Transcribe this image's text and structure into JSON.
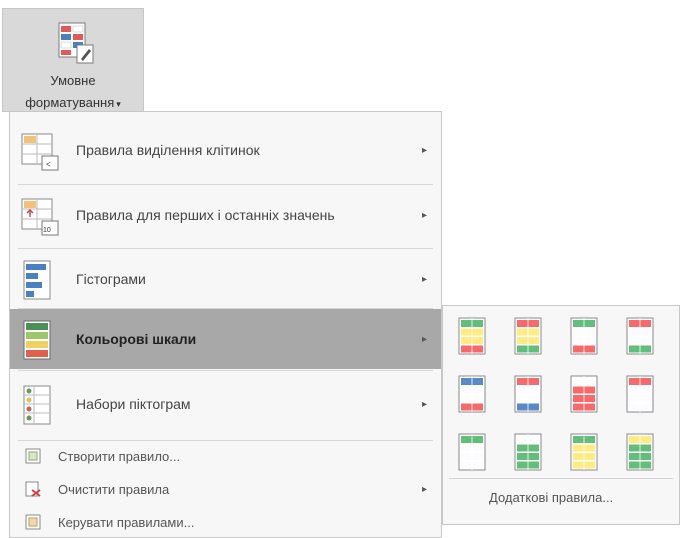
{
  "ribbon": {
    "button_label_line1": "Умовне",
    "button_label_line2": "форматування",
    "dropdown_arrow": "▾",
    "icon": "conditional-formatting-icon"
  },
  "menu": {
    "items": [
      {
        "label": "Правила виділення клітинок",
        "icon": "highlight-cells-rules-icon",
        "has_submenu": true
      },
      {
        "label": "Правила для перших і останніх значень",
        "icon": "top-bottom-rules-icon",
        "has_submenu": true
      },
      {
        "label": "Гістограми",
        "icon": "data-bars-icon",
        "has_submenu": true
      },
      {
        "label": "Кольорові шкали",
        "icon": "color-scales-icon",
        "has_submenu": true,
        "active": true
      },
      {
        "label": "Набори піктограм",
        "icon": "icon-sets-icon",
        "has_submenu": true
      }
    ],
    "small_items": [
      {
        "label": "Створити правило...",
        "icon": "new-rule-icon",
        "has_submenu": false
      },
      {
        "label": "Очистити правила",
        "icon": "clear-rules-icon",
        "has_submenu": true
      },
      {
        "label": "Керувати правилами...",
        "icon": "manage-rules-icon",
        "has_submenu": false
      }
    ],
    "submenu_arrow": "▸"
  },
  "submenu": {
    "more_rules_label": "Додаткові правила...",
    "color_scales": [
      [
        "#63be7b",
        "#ffeb84",
        "#f8696b"
      ],
      [
        "#f8696b",
        "#ffeb84",
        "#63be7b"
      ],
      [
        "#63be7b",
        "#fcfcff",
        "#f8696b"
      ],
      [
        "#f8696b",
        "#fcfcff",
        "#63be7b"
      ],
      [
        "#5a8ac6",
        "#fcfcff",
        "#f8696b"
      ],
      [
        "#f8696b",
        "#fcfcff",
        "#5a8ac6"
      ],
      [
        "#fcfcff",
        "#f8696b",
        "#f8696b"
      ],
      [
        "#f8696b",
        "#fcfcff",
        "#fcfcff"
      ],
      [
        "#63be7b",
        "#fcfcff",
        "#fcfcff"
      ],
      [
        "#fcfcff",
        "#63be7b",
        "#63be7b"
      ],
      [
        "#63be7b",
        "#ffeb84",
        "#ffeb84"
      ],
      [
        "#ffeb84",
        "#63be7b",
        "#63be7b"
      ]
    ]
  }
}
